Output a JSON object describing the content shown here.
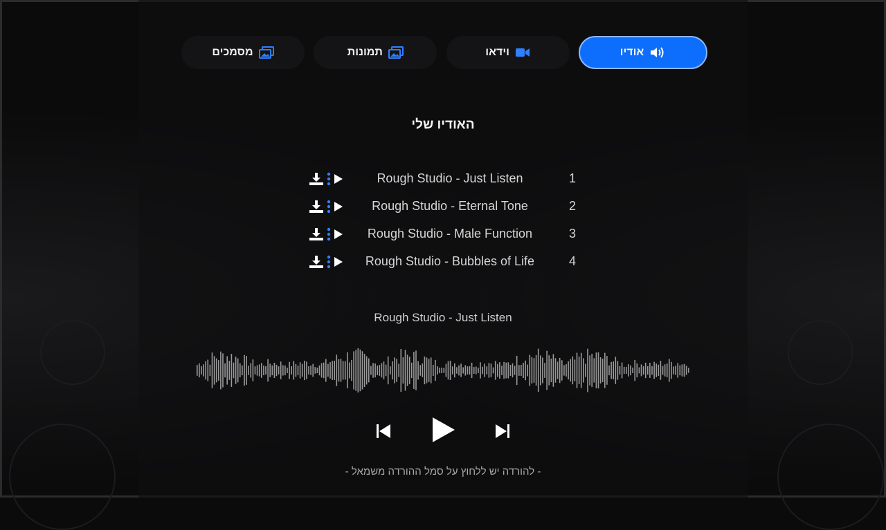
{
  "tabs": [
    {
      "label": "אודיו",
      "icon": "speaker-icon",
      "active": true
    },
    {
      "label": "וידאו",
      "icon": "video-camera-icon",
      "active": false
    },
    {
      "label": "תמונות",
      "icon": "images-icon",
      "active": false
    },
    {
      "label": "מסמכים",
      "icon": "images-icon",
      "active": false
    }
  ],
  "section_title": "האודיו שלי",
  "tracks": [
    {
      "number": "1",
      "title": "Rough Studio - Just Listen"
    },
    {
      "number": "2",
      "title": "Rough Studio - Eternal Tone"
    },
    {
      "number": "3",
      "title": "Rough Studio - Male Function"
    },
    {
      "number": "4",
      "title": "Rough Studio - Bubbles of Life"
    }
  ],
  "player": {
    "now_playing": "Rough Studio - Just Listen"
  },
  "hint": "- להורדה יש ללחוץ על סמל ההורדה משמאל -",
  "colors": {
    "accent": "#0d6efd",
    "background": "#0b0b0c",
    "waveform": "#9a9a9a",
    "icon_blue": "#2f80ff"
  }
}
